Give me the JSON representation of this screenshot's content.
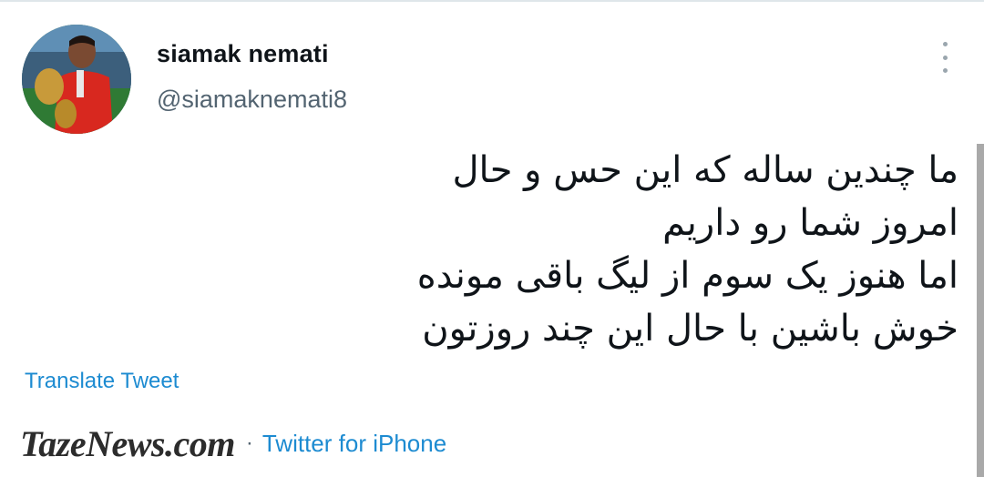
{
  "tweet": {
    "author_name": "siamak nemati",
    "author_handle": "@siamaknemati8",
    "text_lines": [
      "ما چندین ساله که این حس و حال",
      "امروز شما رو داریم",
      "اما هنوز یک سوم از لیگ باقی مونده",
      "خوش باشین با حال این چند روزتون"
    ],
    "translate_label": "Translate Tweet",
    "separator": "·",
    "client": "Twitter for iPhone"
  },
  "watermark": "TazeNews.com",
  "icons": {
    "more": "more-options-icon"
  },
  "colors": {
    "link": "#1d8bd1",
    "handle": "#536471",
    "text": "#0f1419"
  }
}
